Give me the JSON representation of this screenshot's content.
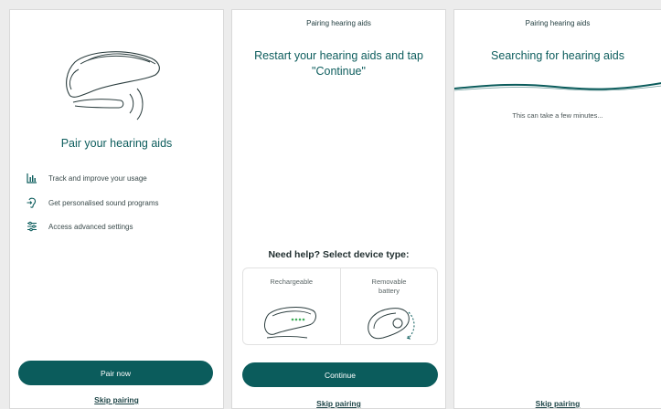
{
  "screen1": {
    "title": "Pair your hearing aids",
    "features": [
      {
        "icon": "bar-chart-icon",
        "label": "Track and improve your usage"
      },
      {
        "icon": "ear-program-icon",
        "label": "Get personalised sound programs"
      },
      {
        "icon": "sliders-icon",
        "label": "Access advanced settings"
      }
    ],
    "primary_button": "Pair now",
    "skip_link": "Skip pairing"
  },
  "screen2": {
    "header": "Pairing hearing aids",
    "title_line1": "Restart your hearing aids and tap",
    "title_line2": "\"Continue\"",
    "help_title": "Need help? Select device type:",
    "device_types": [
      {
        "label": "Rechargeable"
      },
      {
        "label": "Removable battery"
      }
    ],
    "primary_button": "Continue",
    "skip_link": "Skip pairing"
  },
  "screen3": {
    "header": "Pairing hearing aids",
    "title": "Searching for hearing aids",
    "subtext": "This can take a few minutes...",
    "skip_link": "Skip pairing"
  },
  "colors": {
    "accent": "#0b5c5c",
    "title": "#0d5d5d",
    "background": "#ffffff"
  }
}
